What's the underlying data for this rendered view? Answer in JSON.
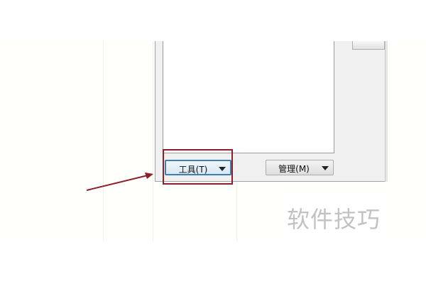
{
  "toolbar": {
    "tools_combo": {
      "label": "工具(T)",
      "focused": true
    },
    "manage_combo": {
      "label": "管理(M)"
    },
    "partial_button": {
      "label": ""
    }
  },
  "watermark": {
    "text": "软件技巧"
  },
  "annotation": {
    "color": "#8b1f2a"
  },
  "colors": {
    "focus_border": "#3c7fb1",
    "dialog_bg": "#f0f0f0"
  }
}
